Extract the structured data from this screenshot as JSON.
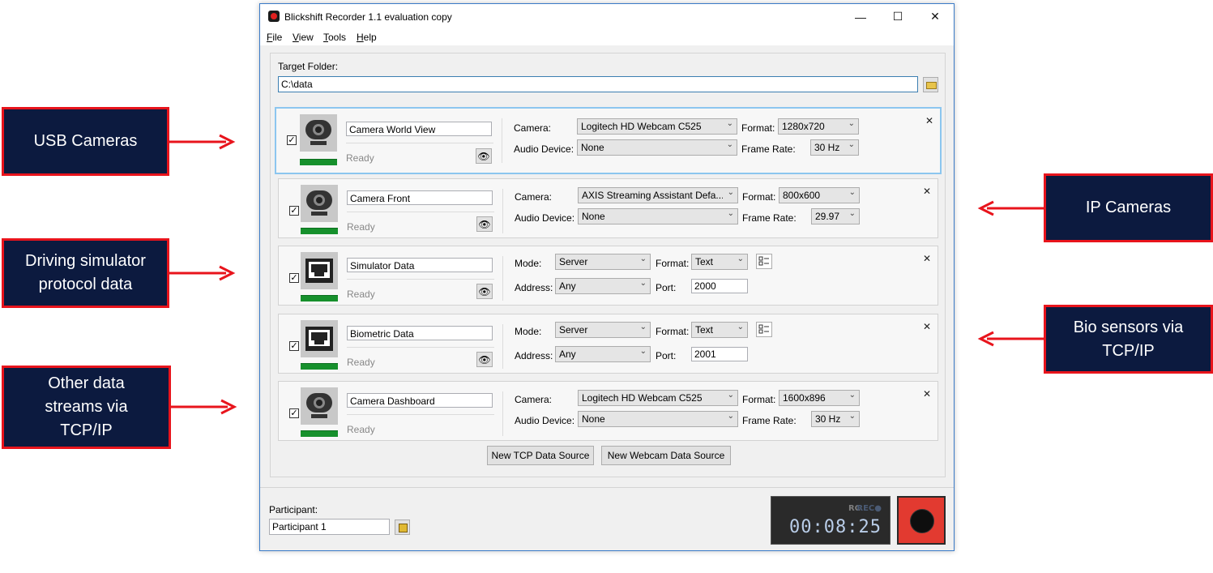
{
  "window": {
    "title": "Blickshift Recorder 1.1 evaluation copy",
    "minimize": "—",
    "maximize": "☐",
    "close": "✕"
  },
  "menu": [
    {
      "accel": "F",
      "rest": "ile"
    },
    {
      "accel": "V",
      "rest": "iew"
    },
    {
      "accel": "T",
      "rest": "ools"
    },
    {
      "accel": "H",
      "rest": "elp"
    }
  ],
  "target": {
    "label": "Target Folder:",
    "value": "C:\\data"
  },
  "sources": [
    {
      "name": "Camera World View",
      "status": "Ready",
      "checked": "✓",
      "fields": {
        "l1": "Camera:",
        "v1": "Logitech HD Webcam C525",
        "l2": "Audio Device:",
        "v2": "None",
        "l3": "Format:",
        "v3": "1280x720",
        "l4": "Frame Rate:",
        "v4": "30 Hz"
      }
    },
    {
      "name": "Camera Front",
      "status": "Ready",
      "checked": "✓",
      "fields": {
        "l1": "Camera:",
        "v1": "AXIS Streaming Assistant Defa...",
        "l2": "Audio Device:",
        "v2": "None",
        "l3": "Format:",
        "v3": "800x600",
        "l4": "Frame Rate:",
        "v4": "29.97"
      }
    },
    {
      "name": "Simulator Data",
      "status": "Ready",
      "checked": "✓",
      "fields": {
        "l1": "Mode:",
        "v1": "Server",
        "l2": "Address:",
        "v2": "Any",
        "l3": "Format:",
        "v3": "Text",
        "l4": "Port:",
        "v4": "2000"
      }
    },
    {
      "name": "Biometric Data",
      "status": "Ready",
      "checked": "✓",
      "fields": {
        "l1": "Mode:",
        "v1": "Server",
        "l2": "Address:",
        "v2": "Any",
        "l3": "Format:",
        "v3": "Text",
        "l4": "Port:",
        "v4": "2001"
      }
    },
    {
      "name": "Camera Dashboard",
      "status": "Ready",
      "checked": "✓",
      "fields": {
        "l1": "Camera:",
        "v1": "Logitech HD Webcam C525",
        "l2": "Audio Device:",
        "v2": "None",
        "l3": "Format:",
        "v3": "1600x896",
        "l4": "Frame Rate:",
        "v4": "30 Hz"
      }
    }
  ],
  "buttons": {
    "new_tcp": "New TCP Data Source",
    "new_webcam": "New Webcam Data Source"
  },
  "participant": {
    "label": "Participant:",
    "value": "Participant 1"
  },
  "recorder": {
    "rc": "RC",
    "rec": "REC●",
    "time": "00:08:25"
  },
  "callouts": {
    "usb": "USB Cameras",
    "driving": "Driving simulator protocol data",
    "other": "Other data streams via TCP/IP",
    "ip": "IP Cameras",
    "bio": "Bio sensors via TCP/IP"
  },
  "colors": {
    "callout_bg": "#0c1a3f",
    "callout_border": "#e8141c",
    "status_green": "#16902c",
    "record_red": "#e23a30"
  }
}
